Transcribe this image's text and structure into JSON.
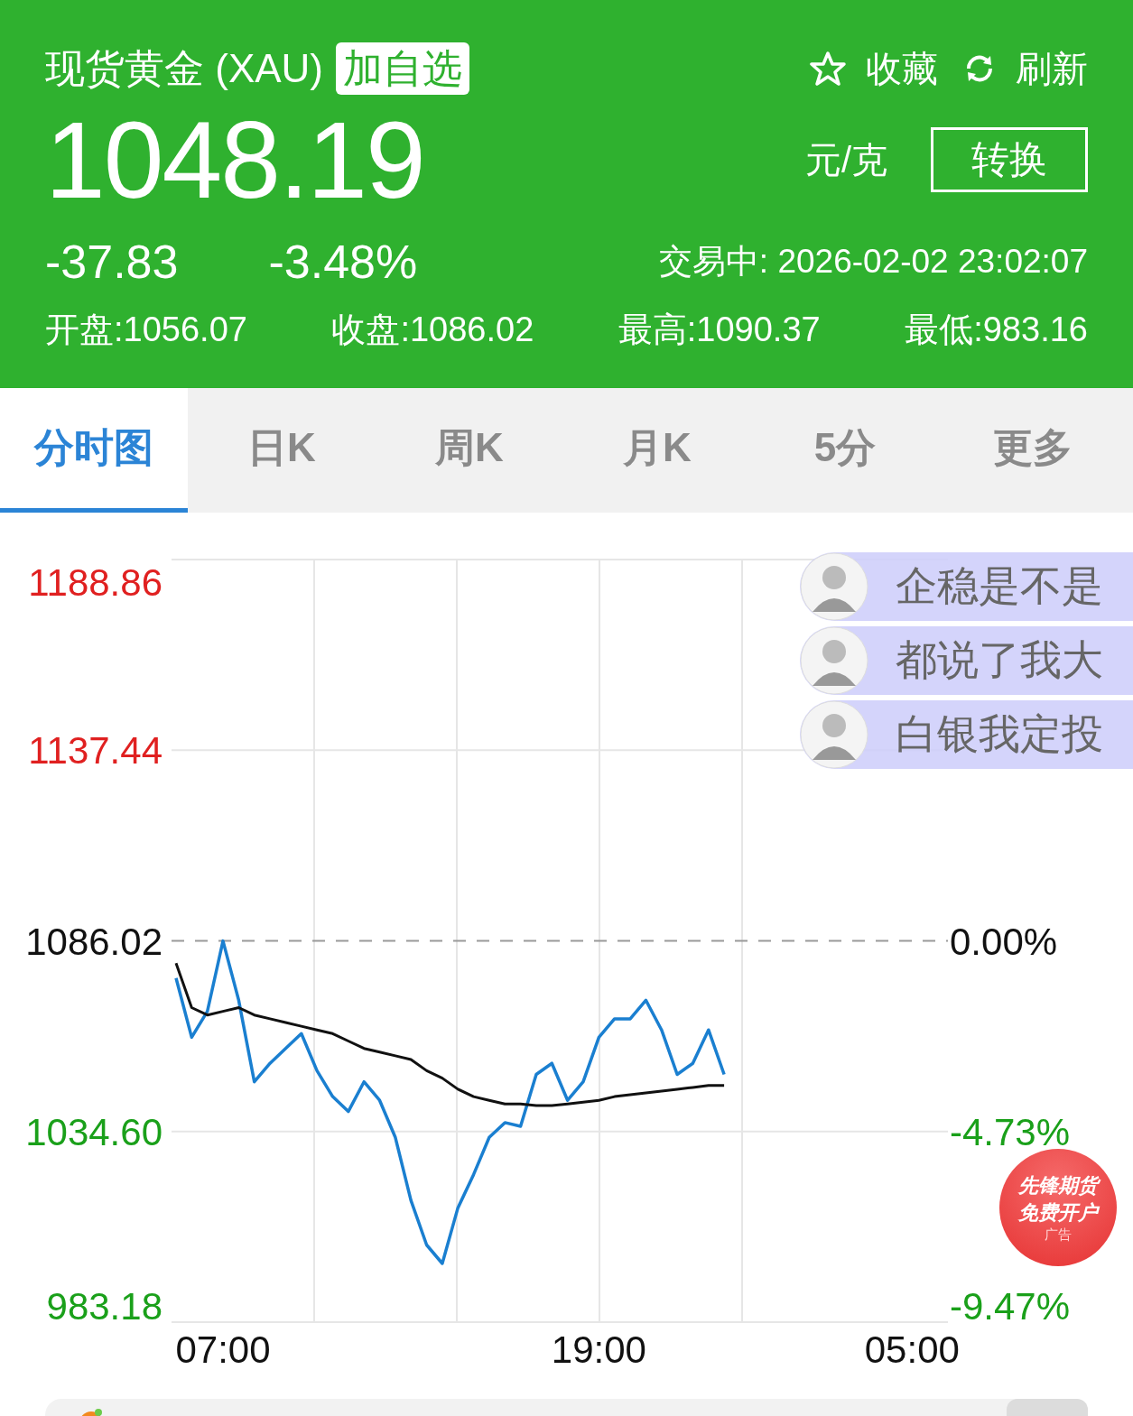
{
  "header": {
    "title": "现货黄金 (XAU)",
    "watch_button": "加自选",
    "actions": [
      {
        "kind": "star",
        "label": "收藏"
      },
      {
        "kind": "refresh",
        "label": "刷新"
      }
    ],
    "price": "1048.19",
    "unit": "元/克",
    "convert_button": "转换",
    "change": "-37.83",
    "change_percent": "-3.48%",
    "status": "交易中: 2026-02-02 23:02:07",
    "stats": [
      "开盘:1056.07",
      "收盘:1086.02",
      "最高:1090.37",
      "最低:983.16"
    ]
  },
  "tabs": [
    {
      "label": "分时图",
      "selected": true
    },
    {
      "label": "日K",
      "selected": false
    },
    {
      "label": "周K",
      "selected": false
    },
    {
      "label": "月K",
      "selected": false
    },
    {
      "label": "5分",
      "selected": false
    },
    {
      "label": "更多",
      "selected": false
    }
  ],
  "chart": {
    "chart_data": {
      "type": "line",
      "categories": [
        null,
        null,
        null,
        "07:00",
        null,
        null,
        null,
        null,
        null,
        null,
        null,
        null,
        null,
        null,
        null,
        null,
        null,
        null,
        null,
        null,
        null,
        null,
        null,
        null,
        null,
        null,
        null,
        "19:00",
        null,
        null,
        null,
        null,
        null,
        null,
        null,
        null,
        null,
        null,
        null,
        null,
        null,
        null,
        null,
        null,
        null,
        null,
        null,
        "05:00",
        null,
        null
      ],
      "series": [
        {
          "color": "#1a7fd0",
          "values": [
            1076,
            1060,
            1067,
            1086,
            1070,
            1048,
            1053,
            1057,
            1061,
            1051,
            1044,
            1040,
            1048,
            1043,
            1033,
            1016,
            1004,
            999,
            1014,
            1023,
            1033,
            1037,
            1036,
            1050,
            1053,
            1043,
            1048,
            1060,
            1065,
            1065,
            1070,
            1062,
            1050,
            1053,
            1062,
            1050,
            null,
            null,
            null,
            null,
            null,
            null,
            null,
            null,
            null,
            null,
            null,
            null,
            null,
            null
          ]
        },
        {
          "color": "#111111",
          "values": [
            1080,
            1068,
            1066,
            1067,
            1068,
            1066,
            1065,
            1064,
            1063,
            1062,
            1061,
            1059,
            1057,
            1056,
            1055,
            1054,
            1051,
            1049,
            1046,
            1044,
            1043,
            1042,
            1042,
            1041.6,
            1041.6,
            1042,
            1042.5,
            1043,
            1044,
            1044.5,
            1045,
            1045.5,
            1046,
            1046.5,
            1047,
            1047,
            null,
            null,
            null,
            null,
            null,
            null,
            null,
            null,
            null,
            null,
            null,
            null,
            null,
            null
          ]
        }
      ],
      "ylim": [
        983.18,
        1188.86
      ],
      "yticks": [
        {
          "value": 1188.86,
          "label": "1188.86"
        },
        {
          "value": 1137.44,
          "label": "1137.44"
        },
        {
          "value": 1086.02,
          "label": "1086.02"
        },
        {
          "value": 1034.6,
          "label": "1034.60"
        },
        {
          "value": 983.18,
          "label": "983.18"
        }
      ],
      "ref_lines": [
        {
          "axis": "y",
          "value": 1086.02
        }
      ]
    },
    "percent_ticks": [
      {
        "label": "0.00%"
      },
      {
        "label": "-4.73%"
      },
      {
        "label": "-9.47%"
      }
    ]
  },
  "comments": [
    {
      "text": "企稳是不是"
    },
    {
      "text": "都说了我大"
    },
    {
      "text": "白银我定投"
    }
  ],
  "ad_badge": {
    "lines": [
      "先锋期货",
      "免费开户"
    ],
    "note": "广告"
  }
}
